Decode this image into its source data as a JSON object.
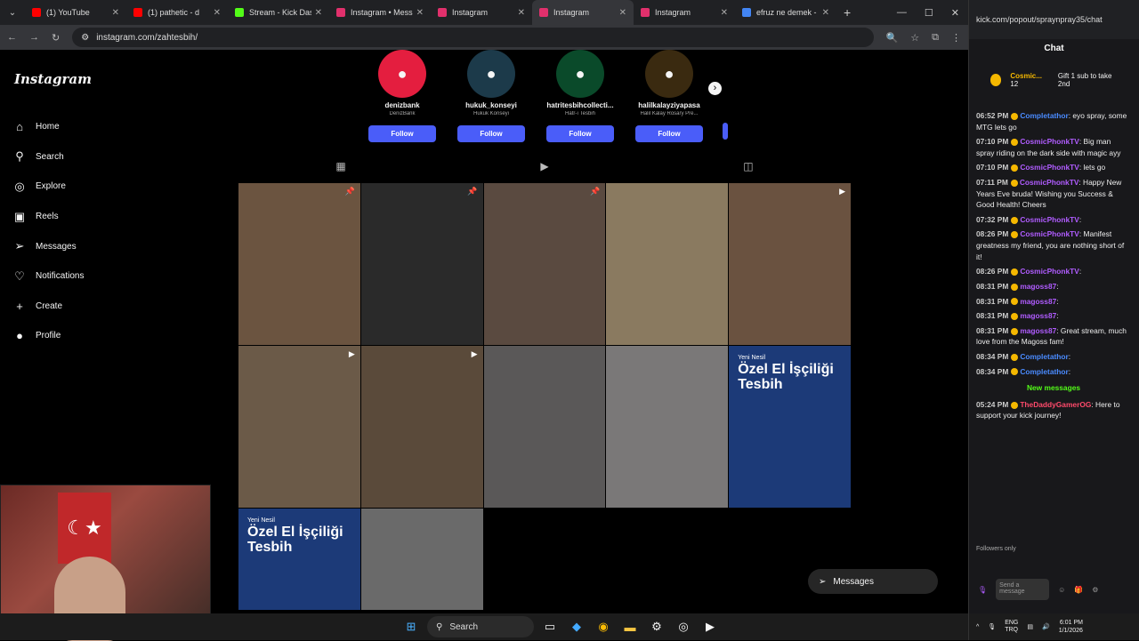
{
  "browser": {
    "tabs": [
      {
        "title": "(1) YouTube",
        "color": "#ff0000"
      },
      {
        "title": "(1) pathetic - d",
        "color": "#ff0000"
      },
      {
        "title": "Stream - Kick Dash",
        "color": "#53fc18"
      },
      {
        "title": "Instagram • Messa",
        "color": "#e1306c"
      },
      {
        "title": "Instagram",
        "color": "#e1306c"
      },
      {
        "title": "Instagram",
        "color": "#e1306c"
      },
      {
        "title": "Instagram",
        "color": "#e1306c"
      },
      {
        "title": "efruz ne demek - G",
        "color": "#4285f4"
      }
    ],
    "url": "instagram.com/zahtesbih/"
  },
  "instagram": {
    "logo": "Instagram",
    "nav": [
      "Home",
      "Search",
      "Explore",
      "Reels",
      "Messages",
      "Notifications",
      "Create",
      "Profile"
    ],
    "suggestions": [
      {
        "username": "denizbank",
        "fullname": "DenizBank",
        "follow": "Follow",
        "color": "#e41e3f"
      },
      {
        "username": "hukuk_konseyi",
        "fullname": "Hukuk Konseyi",
        "follow": "Follow",
        "color": "#1c3a4a"
      },
      {
        "username": "hatritesbihcollecti...",
        "fullname": "Hatr-ı Tesbih",
        "follow": "Follow",
        "color": "#0a4a2a"
      },
      {
        "username": "halilkalayziyapasa",
        "fullname": "Halil Kalay Rosary Pre...",
        "follow": "Follow",
        "color": "#3a2a10"
      }
    ],
    "posts": [
      {
        "bg": "#6b5440",
        "pin": "📌"
      },
      {
        "bg": "#2a2a2a",
        "pin": "📌"
      },
      {
        "bg": "#5a4a40",
        "pin": "📌"
      },
      {
        "bg": "#8a7a60",
        "pin": ""
      },
      {
        "bg": "#6a5240",
        "pin": "▶"
      },
      {
        "bg": "#6b5a48",
        "pin": "▶"
      },
      {
        "bg": "#5a4a3a",
        "pin": "▶"
      },
      {
        "bg": "#5a5858",
        "pin": ""
      },
      {
        "bg": "#7a7878",
        "pin": ""
      },
      {
        "bg": "#1c3a78",
        "pin": "",
        "small": "Yeni Nesil",
        "big": "Özel El İşçiliği Tesbih"
      },
      {
        "bg": "#1c3a78",
        "pin": "",
        "small": "Yeni Nesil",
        "big": "Özel El İşçiliği Tesbih"
      },
      {
        "bg": "#6a6a6a",
        "pin": ""
      }
    ],
    "messages_label": "Messages"
  },
  "taskbar": {
    "search": "Search"
  },
  "kick": {
    "url": "kick.com/popout/spraynpray35/chat",
    "title": "Chat",
    "pinned_user": "Cosmic...",
    "pinned_count": "12",
    "gift": "Gift 1 sub to take 2nd",
    "messages": [
      {
        "time": "06:52 PM",
        "user": "Completathor",
        "color": "#4a8bff",
        "text": ": eyo spray, some MTG lets go"
      },
      {
        "time": "07:10 PM",
        "user": "CosmicPhonkTV",
        "color": "#b05cff",
        "text": ": Big man spray riding on the dark side with magic ayy"
      },
      {
        "time": "07:10 PM",
        "user": "CosmicPhonkTV",
        "color": "#b05cff",
        "text": ": lets go"
      },
      {
        "time": "07:11 PM",
        "user": "CosmicPhonkTV",
        "color": "#b05cff",
        "text": ": Happy New Years Eve bruda! Wishing you Success & Good Health! Cheers"
      },
      {
        "time": "07:32 PM",
        "user": "CosmicPhonkTV",
        "color": "#b05cff",
        "text": ":"
      },
      {
        "time": "08:26 PM",
        "user": "CosmicPhonkTV",
        "color": "#b05cff",
        "text": ": Manifest greatness my friend, you are nothing short of it!"
      },
      {
        "time": "08:26 PM",
        "user": "CosmicPhonkTV",
        "color": "#b05cff",
        "text": ":"
      },
      {
        "time": "08:31 PM",
        "user": "magoss87",
        "color": "#b05cff",
        "text": ":"
      },
      {
        "time": "08:31 PM",
        "user": "magoss87",
        "color": "#b05cff",
        "text": ":"
      },
      {
        "time": "08:31 PM",
        "user": "magoss87",
        "color": "#b05cff",
        "text": ":"
      },
      {
        "time": "08:31 PM",
        "user": "magoss87",
        "color": "#b05cff",
        "text": ": Great stream, much love from the Magoss fam!"
      },
      {
        "time": "08:34 PM",
        "user": "Completathor",
        "color": "#4a8bff",
        "text": ":"
      },
      {
        "time": "08:34 PM",
        "user": "Completathor",
        "color": "#4a8bff",
        "text": ":"
      }
    ],
    "new_messages": "New messages",
    "new": [
      {
        "time": "05:24 PM",
        "user": "TheDaddyGamerOG",
        "color": "#ff4a6b",
        "text": ": Here to support your kick journey!"
      }
    ],
    "followers_only": "Followers only",
    "send_placeholder": "Send a message"
  },
  "tray": {
    "lang": "ENG",
    "layout": "TRQ",
    "time": "6:01 PM",
    "date": "1/1/2026"
  }
}
